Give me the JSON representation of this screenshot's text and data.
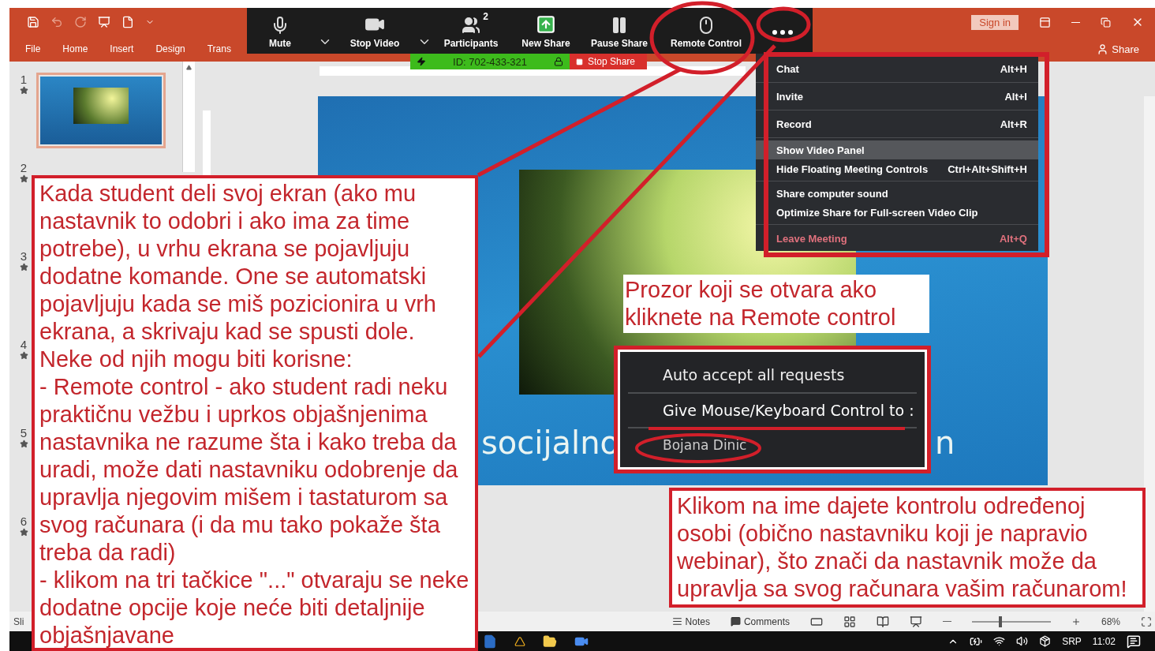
{
  "ribbon": {
    "tabs": [
      "File",
      "Home",
      "Insert",
      "Design",
      "Trans"
    ],
    "sign_in": "Sign in",
    "share": "Share"
  },
  "slides": [
    {
      "number": "1",
      "selected": true
    },
    {
      "number": "2",
      "selected": false
    },
    {
      "number": "3",
      "selected": false
    },
    {
      "number": "4",
      "selected": false
    },
    {
      "number": "5",
      "selected": false
    },
    {
      "number": "6",
      "selected": false
    }
  ],
  "slide": {
    "title_parts": [
      "socijalno",
      "n"
    ]
  },
  "zoom_toolbar": {
    "buttons": [
      {
        "kind": "mute",
        "label": "Mute"
      },
      {
        "kind": "caret"
      },
      {
        "kind": "video",
        "label": "Stop Video"
      },
      {
        "kind": "caret"
      },
      {
        "kind": "participants",
        "label": "Participants",
        "badge": "2"
      },
      {
        "kind": "share",
        "label": "New Share"
      },
      {
        "kind": "pause",
        "label": "Pause Share"
      },
      {
        "kind": "remote",
        "label": "Remote Control"
      },
      {
        "kind": "more"
      }
    ]
  },
  "meeting_bar": {
    "id": "ID: 702-433-321",
    "stop_share": "Stop Share"
  },
  "more_menu": {
    "groups": [
      [
        {
          "label": "Chat",
          "shortcut": "Alt+H",
          "kind": "normal",
          "selected": false
        }
      ],
      [
        {
          "label": "Invite",
          "shortcut": "Alt+I",
          "kind": "normal",
          "selected": false
        }
      ],
      [
        {
          "label": "Record",
          "shortcut": "Alt+R",
          "kind": "normal",
          "selected": false
        }
      ],
      [
        {
          "label": "Show Video Panel",
          "kind": "normal",
          "selected": true
        },
        {
          "label": "Hide Floating Meeting Controls",
          "shortcut": "Ctrl+Alt+Shift+H",
          "kind": "normal",
          "selected": false
        }
      ],
      [
        {
          "label": "Share computer sound",
          "kind": "normal",
          "selected": false
        },
        {
          "label": "Optimize Share for Full-screen Video Clip",
          "kind": "normal",
          "selected": false
        }
      ],
      [
        {
          "label": "Leave Meeting",
          "shortcut": "Alt+Q",
          "kind": "danger",
          "selected": false
        }
      ]
    ]
  },
  "remote_menu": {
    "items": [
      {
        "label": "Auto accept all requests",
        "kind": "option"
      },
      {
        "label": "Give Mouse/Keyboard Control to :",
        "kind": "heading"
      },
      {
        "label": "Bojana Dinic",
        "kind": "person"
      }
    ]
  },
  "annotations": {
    "main": [
      "Kada student deli svoj ekran (ako mu nastavnik to odobri i ako ima za time potrebe), u vrhu ekrana se pojavljuju dodatne komande. One se automatski pojavljuju kada se miš pozicionira u vrh ekrana, a skrivaju kad se spusti dole.",
      "Neke od njih mogu biti korisne:",
      "- Remote control - ako student radi neku praktičnu vežbu i uprkos objašnjenima nastavnika ne razume šta i kako treba da uradi, može dati nastavniku odobrenje da upravlja njegovim mišem i tastaturom sa svog računara (i da mu tako pokaže šta treba da radi)",
      "- klikom na tri tačkice \"...\" otvaraju se neke dodatne opcije koje neće biti detaljnije objašnjavane"
    ],
    "popup_caption": "Prozor koji se otvara ako kliknete na Remote control",
    "name_note": "Klikom na ime dajete kontrolu određenoj osobi (obično nastavniku koji je napravio webinar), što znači da nastavnik može da upravlja sa svog računara vašim računarom!"
  },
  "status_bar": {
    "slide_label": "Sli",
    "notes": "Notes",
    "comments": "Comments",
    "zoom": {
      "level": 0.36
    },
    "zoom_level": "68%"
  },
  "taskbar": {
    "language": "SRP",
    "time": "11:02"
  }
}
